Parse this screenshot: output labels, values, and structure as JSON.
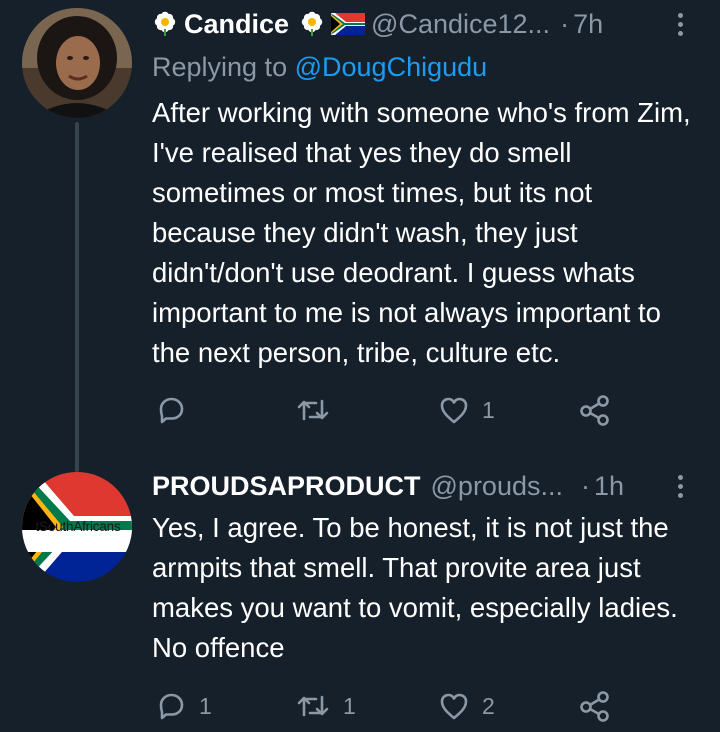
{
  "tweets": [
    {
      "display_name": "Candice",
      "handle": "@Candice12...",
      "time": "7h",
      "replying_prefix": "Replying to",
      "replying_to": "@DougChigudu",
      "text": "After working with someone who's from Zim, I've realised that yes they do smell sometimes or most times, but its not because they didn't wash, they just didn't/don't use deodrant. I guess whats important to me is not always important to the next person, tribe, culture etc.",
      "reply_count": "",
      "retweet_count": "",
      "like_count": "1"
    },
    {
      "display_name": "PROUDSAPRODUCT",
      "handle": "@prouds...",
      "time": "1h",
      "avatar_text": "tSouthAfricans",
      "text": "Yes, I agree. To be honest, it is not just the armpits that smell. That provite area just makes you want to vomit, especially ladies. No offence",
      "reply_count": "1",
      "retweet_count": "1",
      "like_count": "2"
    }
  ],
  "colors": {
    "background": "#15202b",
    "secondary_text": "#8b98a5",
    "link": "#1d9bf0",
    "thread_line": "#38444d"
  },
  "icons": [
    "flower-emoji-icon",
    "south-africa-flag-icon",
    "more-icon",
    "reply-icon",
    "retweet-icon",
    "like-icon",
    "share-icon"
  ]
}
